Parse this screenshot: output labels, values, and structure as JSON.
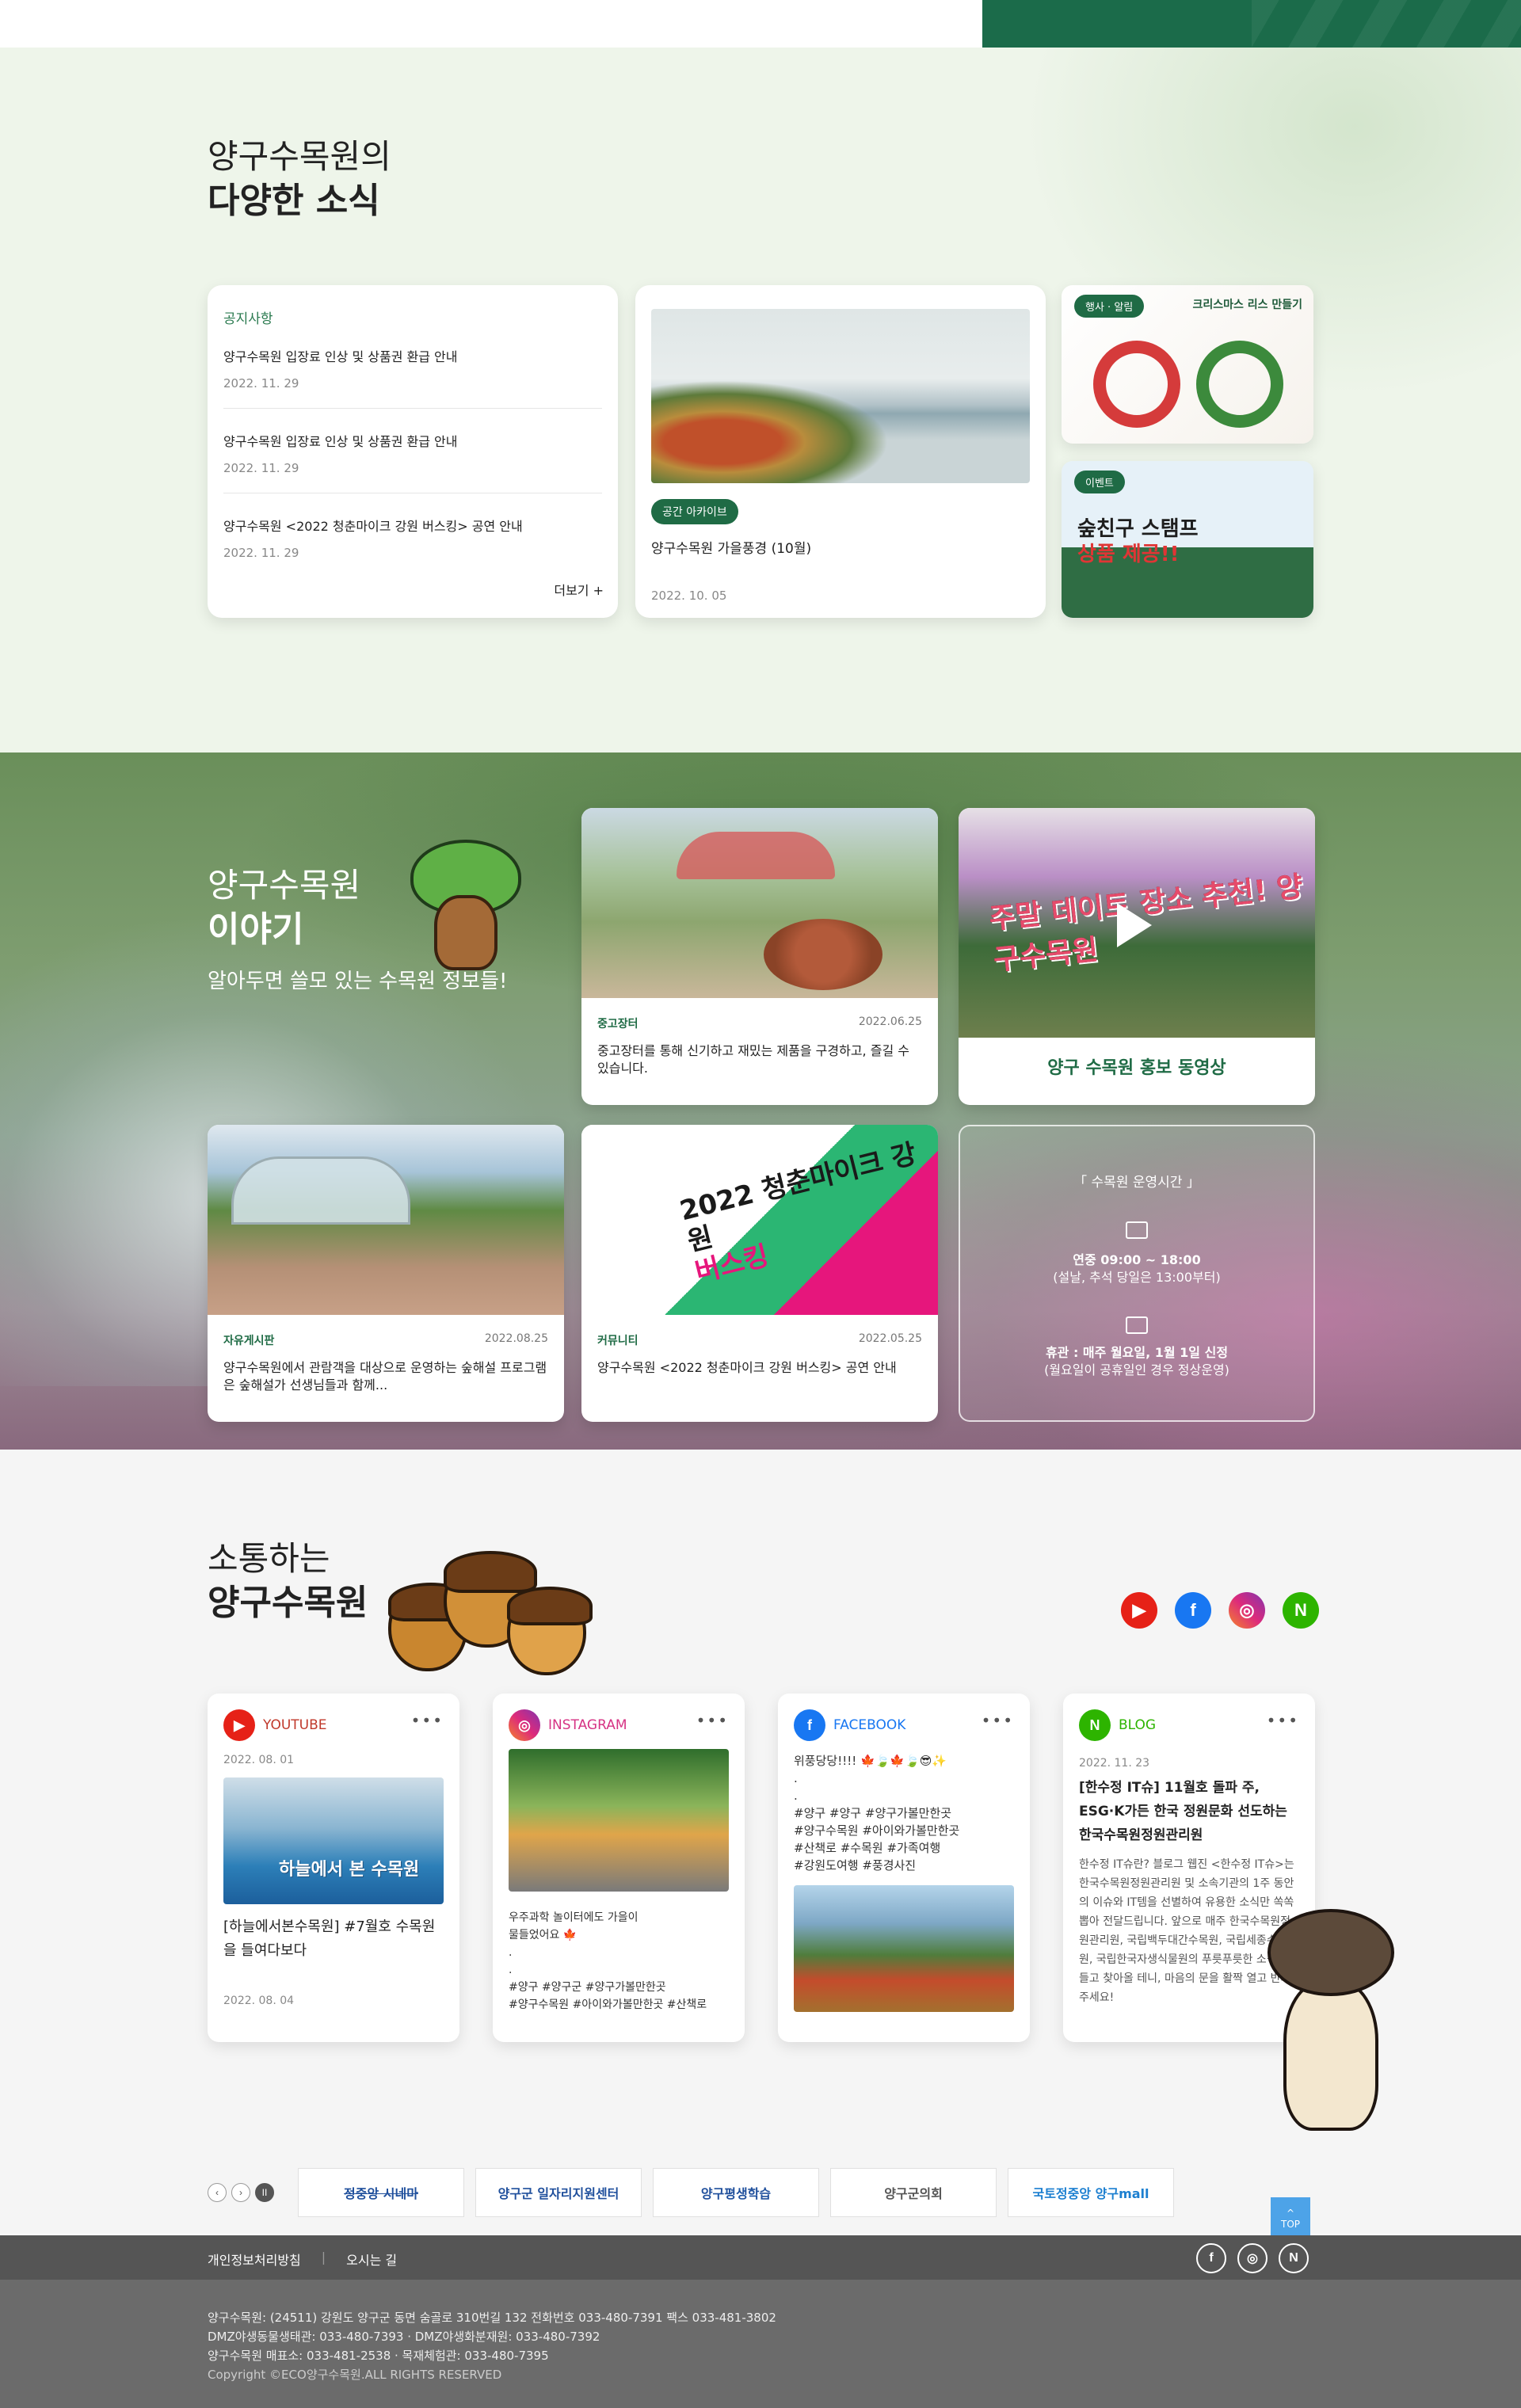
{
  "news": {
    "title_light": "양구수목원의",
    "title_bold": "다양한 소식",
    "notice": {
      "category": "공지사항",
      "items": [
        {
          "title": "양구수목원 입장료 인상 및 상품권 환급 안내",
          "date": "2022. 11. 29"
        },
        {
          "title": "양구수목원 입장료 인상 및 상품권 환급 안내",
          "date": "2022. 11. 29"
        },
        {
          "title": "양구수목원 <2022 청춘마이크 강원 버스킹> 공연 안내",
          "date": "2022. 11. 29"
        }
      ],
      "more": "더보기 +"
    },
    "archive": {
      "badge": "공간 아카이브",
      "title": "양구수목원 가을풍경 (10월)",
      "date": "2022. 10. 05"
    },
    "event1": {
      "badge": "행사 · 알림",
      "headline": "크리스마스 리스 만들기"
    },
    "event2": {
      "badge": "이벤트",
      "headline_a": "숲친구 스탬프",
      "headline_b": "상품 제공!!"
    }
  },
  "story": {
    "title_light": "양구수목원",
    "title_bold": "이야기",
    "subtitle": "알아두면 쓸모 있는 수목원 정보들!",
    "cards": [
      {
        "category": "중고장터",
        "date": "2022.06.25",
        "title": "중고장터를 통해 신기하고 재밌는 제품을 구경하고, 즐길 수 있습니다."
      },
      {
        "title": "양구 수목원 홍보 동영상",
        "overlay": "주말 데이트 장소 추천! 양구수목원"
      },
      {
        "category": "자유게시판",
        "date": "2022.08.25",
        "title": "양구수목원에서 관람객을 대상으로 운영하는 숲해설 프로그램은 숲해설가 선생님들과 함께..."
      },
      {
        "category": "커뮤니티",
        "date": "2022.05.25",
        "title": "양구수목원 <2022 청춘마이크 강원 버스킹> 공연 안내",
        "overlay_a": "2022 청춘마이크 강원",
        "overlay_b": "버스킹"
      }
    ],
    "hours": {
      "heading": "「 수목원 운영시간 」",
      "open_hours": "연중 09:00 ~ 18:00",
      "open_note": "(설날, 추석 당일은 13:00부터)",
      "closed": "휴관 :  매주 월요일, 1월 1일 신정",
      "closed_note": "(월요일이 공휴일인 경우 정상운영)"
    }
  },
  "sns": {
    "title_light": "소통하는",
    "title_bold": "양구수목원",
    "icons": [
      "youtube-icon",
      "facebook-icon",
      "instagram-icon",
      "naver-blog-icon"
    ],
    "youtube": {
      "label": "YOUTUBE",
      "date": "2022. 08. 01",
      "img_text": "하늘에서 본 수목원",
      "title": "[하늘에서본수목원] #7월호 수목원을 들여다보다",
      "date2": "2022. 08. 04"
    },
    "instagram": {
      "label": "INSTAGRAM",
      "text": "우주과학 놀이터에도 가을이\n물들었어요 🍁\n.\n.\n#양구 #양구군 #양구가볼만한곳\n#양구수목원 #아이와가볼만한곳 #산책로"
    },
    "facebook": {
      "label": "FACEBOOK",
      "text": "위풍당당!!!! 🍁🍃🍁🍃😎✨\n.\n.\n#양구 #양구 #양구가볼만한곳\n#양구수목원 #아이와가볼만한곳\n#산책로 #수목원 #가족여행\n#강원도여행 #풍경사진"
    },
    "blog": {
      "label": "BLOG",
      "date": "2022. 11. 23",
      "title": "[한수정 IT슈] 11월호 돌파 주, ESG·K가든 한국 정원문화 선도하는 한국수목원정원관리원",
      "body": "한수정 IT슈란? 블로그 웹진 <한수정 IT슈>는 한국수목원정원관리원 및 소속기관의 1주 동안의 이슈와 IT템을 선별하여 유용한 소식만 쏙쏙 뽑아 전달드립니다. 앞으로 매주 한국수목원정원관리원, 국립백두대간수목원, 국립세종수목원, 국립한국자생식물원의 푸릇푸릇한 소식을 들고 찾아올 테니, 마음의 문을 활짝 열고 반겨 주세요!"
    }
  },
  "partners": {
    "items": [
      "정중앙 시네마",
      "양구군 일자리지원센터",
      "양구평생학습",
      "양구군의회",
      "국토정중앙 양구mall"
    ],
    "top": "TOP"
  },
  "footer": {
    "links": [
      "개인정보처리방침",
      "오시는 길"
    ],
    "lines": [
      "양구수목원: (24511) 강원도 양구군 동면 숨골로 310번길 132 전화번호 033-480-7391 팩스 033-481-3802",
      "DMZ야생동물생태관: 033-480-7393 · DMZ야생화분재원: 033-480-7392",
      "양구수목원 매표소: 033-481-2538 · 목재체험관: 033-480-7395"
    ],
    "copyright": "Copyright ©ECO양구수목원.ALL RIGHTS RESERVED"
  }
}
